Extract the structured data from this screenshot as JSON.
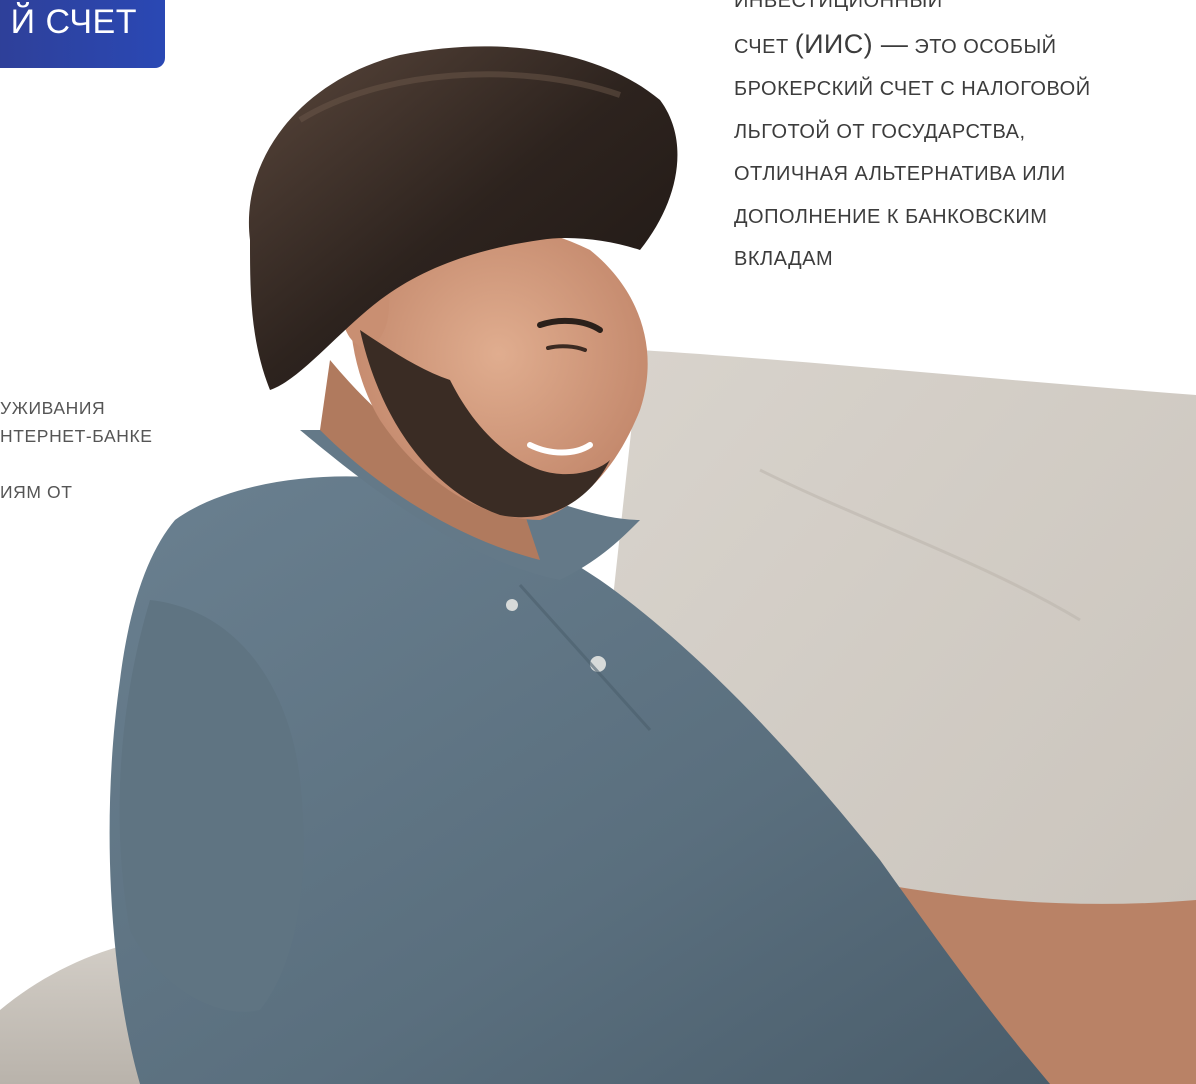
{
  "title_badge": {
    "text": "Й СЧЕТ"
  },
  "description": {
    "line1": "ИНВЕСТИЦИОННЫЙ",
    "line2_prefix": "СЧЕТ ",
    "line2_big": "(ИИС) —",
    "line2_suffix": " ЭТО ОСОБЫЙ",
    "line3": "БРОКЕРСКИЙ СЧЕТ С НАЛОГОВОЙ",
    "line4": "ЛЬГОТОЙ ОТ ГОСУДАРСТВА,",
    "line5": "ОТЛИЧНАЯ АЛЬТЕРНАТИВА ИЛИ",
    "line6": "ДОПОЛНЕНИЕ К БАНКОВСКИМ",
    "line7": "ВКЛАДАМ"
  },
  "left_list": {
    "item1": "УЖИВАНИЯ",
    "item2": "НТЕРНЕТ-БАНКЕ",
    "item3": "ИЯМ ОТ"
  },
  "colors": {
    "badge_start": "#2f3f96",
    "badge_end": "#2a48b4",
    "text": "#3c3c3c",
    "sofa": "#d6d1ca",
    "shirt": "#5d7383",
    "hair": "#2b211c",
    "skin": "#cf9a7c"
  }
}
